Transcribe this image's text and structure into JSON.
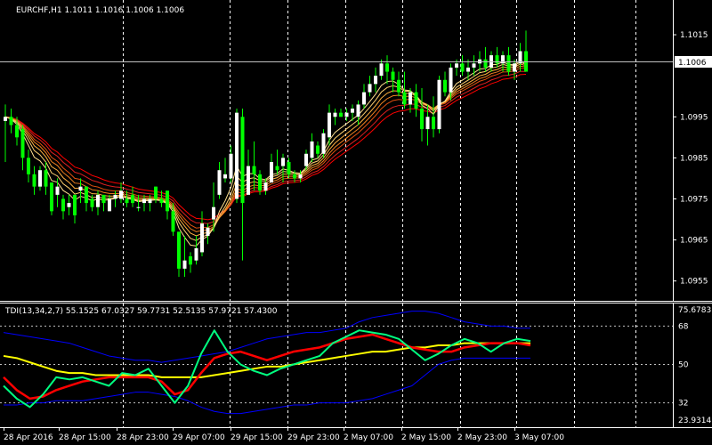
{
  "main_header": "EURCHF,H1  1.1011 1.1016 1.1006 1.1006",
  "indicator_header": "TDI(13,34,2,7) 55.1525 67.0327 59.7731 52.5135 57.9721 57.4300",
  "current_price": "1.1006",
  "price_axis": [
    "1.1015",
    "1.0995",
    "1.0985",
    "1.0975",
    "1.0965",
    "1.0955"
  ],
  "indicator_axis": [
    "75.6783",
    "68",
    "50",
    "32",
    "23.9314"
  ],
  "time_axis": [
    "28 Apr 2016",
    "28 Apr 15:00",
    "28 Apr 23:00",
    "29 Apr 07:00",
    "29 Apr 15:00",
    "29 Apr 23:00",
    "2 May 07:00",
    "2 May 15:00",
    "2 May 23:00",
    "3 May 07:00"
  ],
  "colors": {
    "background": "#000000",
    "bull_candle": "#ffffff",
    "bear_candle": "#00ff00",
    "wick": "#00ff00",
    "ma_shades": [
      "#ff0000",
      "#e02020",
      "#e05010",
      "#f08020",
      "#ffb040",
      "#ffd070",
      "#ffe090"
    ],
    "tdi_upper_lower_band": "#0000ff",
    "tdi_rsi_price": "#00ff80",
    "tdi_signal": "#ff0000",
    "tdi_market_base": "#ffff00",
    "grid": "#ffffff"
  },
  "chart_data": {
    "type": "candlestick",
    "symbol": "EURCHF",
    "timeframe": "H1",
    "ohlc": {
      "open": 1.1011,
      "high": 1.1016,
      "low": 1.1006,
      "close": 1.1006
    },
    "price_ylim": [
      1.09506,
      1.10226
    ],
    "indicator_ylim": [
      23.9314,
      75.6783
    ],
    "candles": [
      [
        1.0994,
        1.0998,
        1.0984,
        1.0995
      ],
      [
        1.0995,
        1.0997,
        1.0991,
        1.0993
      ],
      [
        1.0993,
        1.0995,
        1.0988,
        1.099
      ],
      [
        1.0992,
        1.0993,
        1.0982,
        1.0985
      ],
      [
        1.0985,
        1.0987,
        1.0979,
        1.0981
      ],
      [
        1.0981,
        1.0983,
        1.0976,
        1.0978
      ],
      [
        1.0978,
        1.0983,
        1.0977,
        1.0982
      ],
      [
        1.0982,
        1.0984,
        1.0976,
        1.0978
      ],
      [
        1.0979,
        1.0979,
        1.0971,
        1.0972
      ],
      [
        1.0976,
        1.098,
        1.0973,
        1.0978
      ],
      [
        1.0975,
        1.0976,
        1.097,
        1.0972
      ],
      [
        1.0973,
        1.0976,
        1.0971,
        1.0974
      ],
      [
        1.0976,
        1.0976,
        1.0969,
        1.0971
      ],
      [
        1.0977,
        1.098,
        1.0974,
        1.0978
      ],
      [
        1.0978,
        1.0978,
        1.0972,
        1.0974
      ],
      [
        1.0975,
        1.0976,
        1.0972,
        1.0973
      ],
      [
        1.0973,
        1.0977,
        1.0971,
        1.0976
      ],
      [
        1.0976,
        1.0976,
        1.0972,
        1.0974
      ],
      [
        1.0972,
        1.0976,
        1.0972,
        1.0975
      ],
      [
        1.0975,
        1.0977,
        1.0973,
        1.0976
      ],
      [
        1.0975,
        1.0979,
        1.0974,
        1.0977
      ],
      [
        1.0975,
        1.0977,
        1.0973,
        1.0974
      ],
      [
        1.0976,
        1.0978,
        1.0973,
        1.0974
      ],
      [
        1.0973,
        1.0976,
        1.0972,
        1.0973
      ],
      [
        1.0974,
        1.0976,
        1.0972,
        1.0975
      ],
      [
        1.0974,
        1.0976,
        1.0972,
        1.0975
      ],
      [
        1.0978,
        1.0978,
        1.0974,
        1.0975
      ],
      [
        1.0975,
        1.0977,
        1.0973,
        1.0974
      ],
      [
        1.0977,
        1.0977,
        1.097,
        1.0972
      ],
      [
        1.0972,
        1.0974,
        1.0966,
        1.0967
      ],
      [
        1.0967,
        1.0967,
        1.0956,
        1.0958
      ],
      [
        1.0958,
        1.0966,
        1.0956,
        1.096
      ],
      [
        1.0961,
        1.0962,
        1.0957,
        1.0959
      ],
      [
        1.096,
        1.0966,
        1.0959,
        1.0963
      ],
      [
        1.0962,
        1.0972,
        1.0961,
        1.0969
      ],
      [
        1.0966,
        1.0969,
        1.0964,
        1.0968
      ],
      [
        1.097,
        1.0979,
        1.0967,
        1.0973
      ],
      [
        1.0976,
        1.0984,
        1.0975,
        1.0982
      ],
      [
        1.098,
        1.0985,
        1.0979,
        1.0981
      ],
      [
        1.098,
        1.0988,
        1.0979,
        1.0986
      ],
      [
        1.0975,
        1.0997,
        1.0974,
        1.0996
      ],
      [
        1.0995,
        1.0997,
        1.096,
        1.0974
      ],
      [
        1.0976,
        1.0987,
        1.0976,
        1.0983
      ],
      [
        1.0983,
        1.0989,
        1.0977,
        1.0981
      ],
      [
        1.0981,
        1.0982,
        1.0976,
        1.0977
      ],
      [
        1.0977,
        1.098,
        1.0976,
        1.0979
      ],
      [
        1.0979,
        1.0986,
        1.0979,
        1.0984
      ],
      [
        1.0983,
        1.0987,
        1.0981,
        1.0982
      ],
      [
        1.0983,
        1.0986,
        1.0979,
        1.0985
      ],
      [
        1.0984,
        1.0985,
        1.098,
        1.0981
      ],
      [
        1.0981,
        1.0982,
        1.0979,
        1.098
      ],
      [
        1.098,
        1.0982,
        1.0979,
        1.0981
      ],
      [
        1.0983,
        1.0987,
        1.0982,
        1.0986
      ],
      [
        1.0985,
        1.0991,
        1.0984,
        1.0989
      ],
      [
        1.0988,
        1.0989,
        1.0985,
        1.0986
      ],
      [
        1.0986,
        1.0992,
        1.0985,
        1.0991
      ],
      [
        1.099,
        1.0998,
        1.0988,
        1.0996
      ],
      [
        1.0995,
        1.0997,
        1.0993,
        1.0996
      ],
      [
        1.0996,
        1.0997,
        1.0995,
        1.0995
      ],
      [
        1.0995,
        1.0997,
        1.0994,
        1.0996
      ],
      [
        1.0996,
        1.0998,
        1.0994,
        1.0997
      ],
      [
        1.0995,
        1.0999,
        1.0993,
        1.0998
      ],
      [
        1.0998,
        1.1003,
        1.0997,
        1.1001
      ],
      [
        1.1001,
        1.1005,
        1.1,
        1.1003
      ],
      [
        1.1003,
        1.1007,
        1.1001,
        1.1005
      ],
      [
        1.1005,
        1.1009,
        1.1004,
        1.1008
      ],
      [
        1.1008,
        1.101,
        1.1003,
        1.1006
      ],
      [
        1.1006,
        1.1007,
        1.1001,
        1.1004
      ],
      [
        1.1004,
        1.1006,
        1.1,
        1.1001
      ],
      [
        1.1001,
        1.1006,
        1.0997,
        1.0998
      ],
      [
        1.0998,
        1.1002,
        1.0996,
        1.1001
      ],
      [
        1.1001,
        1.1003,
        1.0995,
        1.0997
      ],
      [
        1.0997,
        1.1002,
        1.0989,
        1.0992
      ],
      [
        1.0992,
        1.0998,
        1.0988,
        1.0995
      ],
      [
        1.0995,
        1.1,
        1.099,
        1.0992
      ],
      [
        1.0992,
        1.1005,
        1.0991,
        1.1004
      ],
      [
        1.1004,
        1.1006,
        1.1,
        1.1001
      ],
      [
        1.1001,
        1.1008,
        1.0999,
        1.1007
      ],
      [
        1.1007,
        1.1009,
        1.1005,
        1.1008
      ],
      [
        1.1008,
        1.101,
        1.1005,
        1.1006
      ],
      [
        1.1006,
        1.1009,
        1.1004,
        1.1007
      ],
      [
        1.1007,
        1.101,
        1.1005,
        1.1008
      ],
      [
        1.1008,
        1.1011,
        1.1006,
        1.1009
      ],
      [
        1.1009,
        1.1012,
        1.1006,
        1.1007
      ],
      [
        1.1007,
        1.1011,
        1.1006,
        1.101
      ],
      [
        1.101,
        1.1012,
        1.1007,
        1.1008
      ],
      [
        1.1008,
        1.1011,
        1.1006,
        1.101
      ],
      [
        1.101,
        1.1012,
        1.1005,
        1.1006
      ],
      [
        1.1006,
        1.1009,
        1.1004,
        1.1008
      ],
      [
        1.1008,
        1.1013,
        1.1006,
        1.1011
      ],
      [
        1.1011,
        1.1016,
        1.1006,
        1.1006
      ]
    ],
    "tdi": {
      "upper_band": [
        65,
        64,
        63,
        62,
        61,
        60,
        58,
        56,
        54,
        53,
        52,
        52,
        51,
        52,
        53,
        54,
        55,
        56,
        58,
        60,
        62,
        63,
        64,
        65,
        65,
        66,
        67,
        70,
        72,
        73,
        74,
        75,
        75,
        74,
        72,
        70,
        69,
        68,
        68,
        67,
        67
      ],
      "lower_band": [
        31,
        31,
        32,
        32,
        33,
        33,
        33,
        34,
        35,
        36,
        37,
        37,
        36,
        35,
        33,
        30,
        28,
        27,
        27,
        28,
        29,
        30,
        31,
        31,
        32,
        32,
        32,
        33,
        34,
        36,
        38,
        40,
        45,
        50,
        52,
        53,
        53,
        53,
        53,
        53,
        53
      ],
      "rsi_price_line": [
        40,
        34,
        30,
        36,
        44,
        43,
        44,
        42,
        40,
        46,
        45,
        48,
        40,
        32,
        40,
        55,
        66,
        56,
        50,
        47,
        45,
        48,
        50,
        52,
        54,
        60,
        63,
        66,
        65,
        64,
        62,
        57,
        52,
        55,
        59,
        62,
        60,
        56,
        60,
        62,
        61
      ],
      "signal_line": [
        44,
        38,
        34,
        35,
        38,
        40,
        42,
        43,
        44,
        44,
        44,
        44,
        42,
        36,
        38,
        46,
        53,
        55,
        56,
        54,
        52,
        54,
        56,
        57,
        58,
        60,
        62,
        63,
        64,
        62,
        60,
        58,
        57,
        56,
        56,
        58,
        59,
        60,
        60,
        60,
        59
      ],
      "market_base_line": [
        54,
        53,
        51,
        49,
        47,
        46,
        46,
        45,
        45,
        45,
        45,
        45,
        44,
        44,
        44,
        44,
        45,
        46,
        47,
        48,
        49,
        49,
        50,
        51,
        52,
        53,
        54,
        55,
        56,
        56,
        57,
        58,
        58,
        59,
        59,
        60,
        60,
        60,
        60,
        60,
        60
      ]
    }
  }
}
